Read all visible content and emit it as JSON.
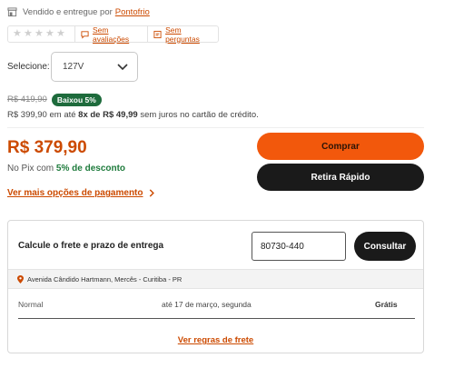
{
  "seller": {
    "prefix": "Vendido e entregue por",
    "name": "Pontofrio"
  },
  "rating": {
    "stars_filled": 0,
    "stars_total": 5,
    "reviews_link": "Sem avaliações",
    "questions_link": "Sem perguntas"
  },
  "variant": {
    "label": "Selecione:",
    "selected": "127V"
  },
  "pricing": {
    "old_price": "R$ 419,90",
    "discount_badge": "Baixou 5%",
    "installments_prefix": "R$ 399,90 em até",
    "installments_count": "8x de R$ 49,99",
    "installments_suffix": "sem juros no cartão de crédito.",
    "main_price": "R$ 379,90",
    "pix_prefix": "No Pix com",
    "pix_discount": "5% de desconto",
    "more_payment_options": "Ver mais opções de pagamento"
  },
  "actions": {
    "buy": "Comprar",
    "pickup": "Retira Rápido"
  },
  "shipping": {
    "title": "Calcule o frete e prazo de entrega",
    "cep_value": "80730-440",
    "consult": "Consultar",
    "address": "Avenida Cândido Hartmann, Mercês - Curitiba - PR",
    "options": [
      {
        "type": "Normal",
        "eta": "até 17 de março, segunda",
        "price": "Grátis"
      }
    ],
    "rules_link": "Ver regras de frete"
  },
  "colors": {
    "accent": "#f2580c",
    "link": "#cc4a00",
    "success": "#1e6b3c",
    "dark_button": "#1a1a1a"
  }
}
